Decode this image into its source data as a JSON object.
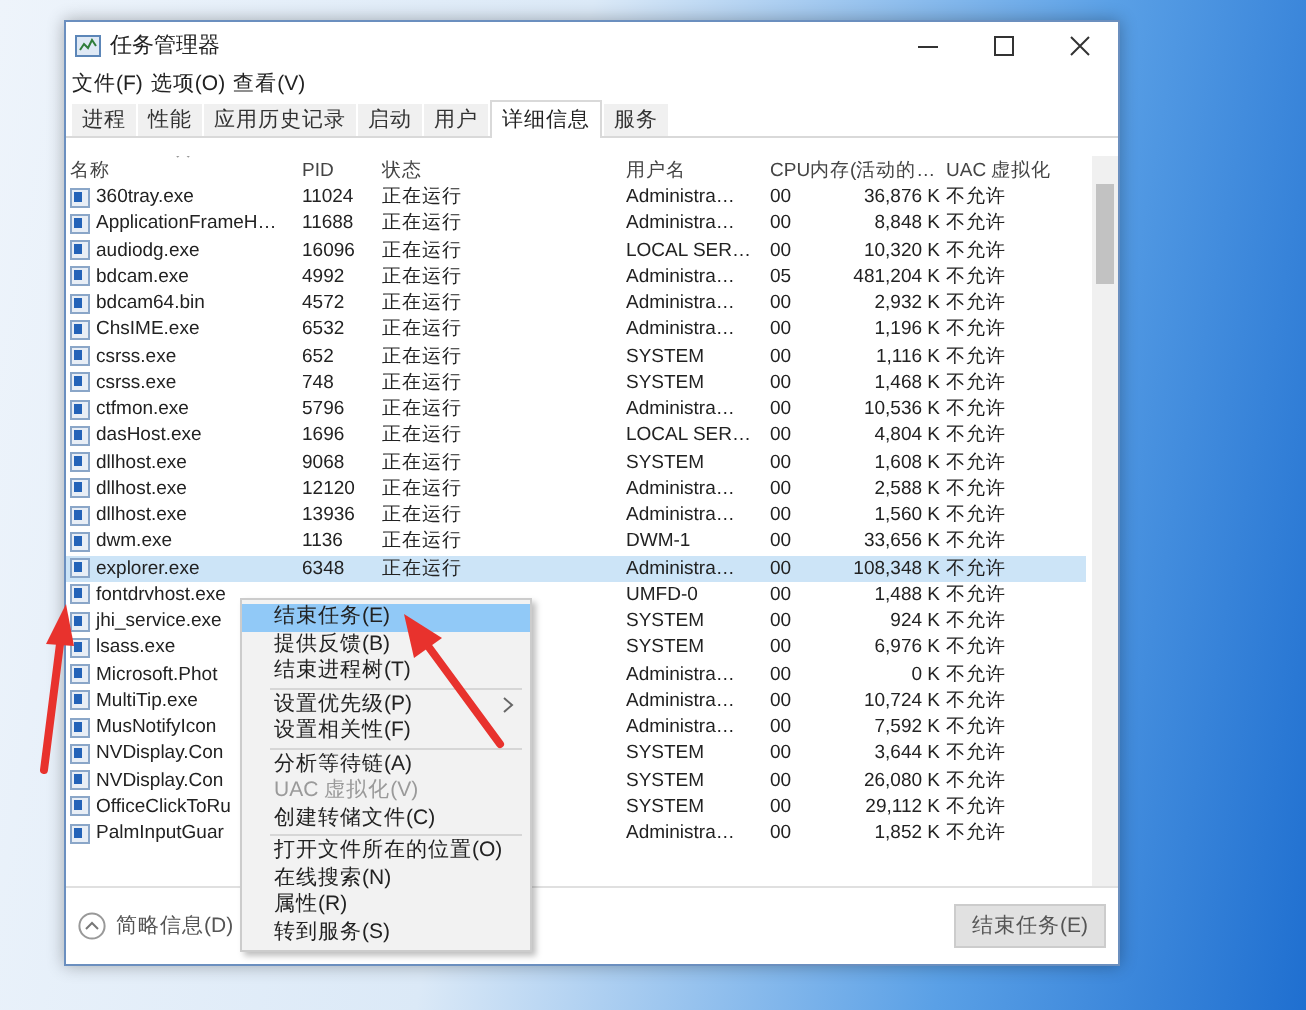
{
  "window": {
    "title": "任务管理器"
  },
  "menu_bar": [
    "文件(F)",
    "选项(O)",
    "查看(V)"
  ],
  "tabs": [
    {
      "label": "进程",
      "selected": false
    },
    {
      "label": "性能",
      "selected": false
    },
    {
      "label": "应用历史记录",
      "selected": false
    },
    {
      "label": "启动",
      "selected": false
    },
    {
      "label": "用户",
      "selected": false
    },
    {
      "label": "详细信息",
      "selected": true
    },
    {
      "label": "服务",
      "selected": false
    }
  ],
  "table": {
    "columns": [
      "名称",
      "PID",
      "状态",
      "用户名",
      "CPU",
      "内存(活动的…",
      "UAC 虚拟化"
    ],
    "rows": [
      {
        "name": "360tray.exe",
        "pid": "11024",
        "status": "正在运行",
        "user": "Administra…",
        "cpu": "00",
        "memory": "36,876 K",
        "uac": "不允许",
        "selected": false
      },
      {
        "name": "ApplicationFrameH…",
        "pid": "11688",
        "status": "正在运行",
        "user": "Administra…",
        "cpu": "00",
        "memory": "8,848 K",
        "uac": "不允许",
        "selected": false
      },
      {
        "name": "audiodg.exe",
        "pid": "16096",
        "status": "正在运行",
        "user": "LOCAL SER…",
        "cpu": "00",
        "memory": "10,320 K",
        "uac": "不允许",
        "selected": false
      },
      {
        "name": "bdcam.exe",
        "pid": "4992",
        "status": "正在运行",
        "user": "Administra…",
        "cpu": "05",
        "memory": "481,204 K",
        "uac": "不允许",
        "selected": false
      },
      {
        "name": "bdcam64.bin",
        "pid": "4572",
        "status": "正在运行",
        "user": "Administra…",
        "cpu": "00",
        "memory": "2,932 K",
        "uac": "不允许",
        "selected": false
      },
      {
        "name": "ChsIME.exe",
        "pid": "6532",
        "status": "正在运行",
        "user": "Administra…",
        "cpu": "00",
        "memory": "1,196 K",
        "uac": "不允许",
        "selected": false
      },
      {
        "name": "csrss.exe",
        "pid": "652",
        "status": "正在运行",
        "user": "SYSTEM",
        "cpu": "00",
        "memory": "1,116 K",
        "uac": "不允许",
        "selected": false
      },
      {
        "name": "csrss.exe",
        "pid": "748",
        "status": "正在运行",
        "user": "SYSTEM",
        "cpu": "00",
        "memory": "1,468 K",
        "uac": "不允许",
        "selected": false
      },
      {
        "name": "ctfmon.exe",
        "pid": "5796",
        "status": "正在运行",
        "user": "Administra…",
        "cpu": "00",
        "memory": "10,536 K",
        "uac": "不允许",
        "selected": false
      },
      {
        "name": "dasHost.exe",
        "pid": "1696",
        "status": "正在运行",
        "user": "LOCAL SER…",
        "cpu": "00",
        "memory": "4,804 K",
        "uac": "不允许",
        "selected": false
      },
      {
        "name": "dllhost.exe",
        "pid": "9068",
        "status": "正在运行",
        "user": "SYSTEM",
        "cpu": "00",
        "memory": "1,608 K",
        "uac": "不允许",
        "selected": false
      },
      {
        "name": "dllhost.exe",
        "pid": "12120",
        "status": "正在运行",
        "user": "Administra…",
        "cpu": "00",
        "memory": "2,588 K",
        "uac": "不允许",
        "selected": false
      },
      {
        "name": "dllhost.exe",
        "pid": "13936",
        "status": "正在运行",
        "user": "Administra…",
        "cpu": "00",
        "memory": "1,560 K",
        "uac": "不允许",
        "selected": false
      },
      {
        "name": "dwm.exe",
        "pid": "1136",
        "status": "正在运行",
        "user": "DWM-1",
        "cpu": "00",
        "memory": "33,656 K",
        "uac": "不允许",
        "selected": false
      },
      {
        "name": "explorer.exe",
        "pid": "6348",
        "status": "正在运行",
        "user": "Administra…",
        "cpu": "00",
        "memory": "108,348 K",
        "uac": "不允许",
        "selected": true
      },
      {
        "name": "fontdrvhost.exe",
        "user": "UMFD-0",
        "cpu": "00",
        "memory": "1,488 K",
        "uac": "不允许",
        "selected": false
      },
      {
        "name": "jhi_service.exe",
        "user": "SYSTEM",
        "cpu": "00",
        "memory": "924 K",
        "uac": "不允许",
        "selected": false
      },
      {
        "name": "lsass.exe",
        "user": "SYSTEM",
        "cpu": "00",
        "memory": "6,976 K",
        "uac": "不允许",
        "selected": false
      },
      {
        "name": "Microsoft.Phot",
        "user": "Administra…",
        "cpu": "00",
        "memory": "0 K",
        "uac": "不允许",
        "selected": false
      },
      {
        "name": "MultiTip.exe",
        "user": "Administra…",
        "cpu": "00",
        "memory": "10,724 K",
        "uac": "不允许",
        "selected": false
      },
      {
        "name": "MusNotifyIcon",
        "user": "Administra…",
        "cpu": "00",
        "memory": "7,592 K",
        "uac": "不允许",
        "selected": false
      },
      {
        "name": "NVDisplay.Con",
        "user": "SYSTEM",
        "cpu": "00",
        "memory": "3,644 K",
        "uac": "不允许",
        "selected": false
      },
      {
        "name": "NVDisplay.Con",
        "user": "SYSTEM",
        "cpu": "00",
        "memory": "26,080 K",
        "uac": "不允许",
        "selected": false
      },
      {
        "name": "OfficeClickToRu",
        "user": "SYSTEM",
        "cpu": "00",
        "memory": "29,112 K",
        "uac": "不允许",
        "selected": false
      },
      {
        "name": "PalmInputGuar",
        "user": "Administra…",
        "cpu": "00",
        "memory": "1,852 K",
        "uac": "不允许",
        "selected": false
      }
    ]
  },
  "context_menu": [
    {
      "kind": "item",
      "label": "结束任务(E)",
      "selected": true,
      "disabled": false
    },
    {
      "kind": "item",
      "label": "提供反馈(B)",
      "selected": false,
      "disabled": false
    },
    {
      "kind": "item",
      "label": "结束进程树(T)",
      "selected": false,
      "disabled": false
    },
    {
      "kind": "separator"
    },
    {
      "kind": "item",
      "label": "设置优先级(P)",
      "selected": false,
      "disabled": false,
      "submenu": true
    },
    {
      "kind": "item",
      "label": "设置相关性(F)",
      "selected": false,
      "disabled": false
    },
    {
      "kind": "separator"
    },
    {
      "kind": "item",
      "label": "分析等待链(A)",
      "selected": false,
      "disabled": false
    },
    {
      "kind": "item",
      "label": "UAC 虚拟化(V)",
      "selected": false,
      "disabled": true
    },
    {
      "kind": "item",
      "label": "创建转储文件(C)",
      "selected": false,
      "disabled": false
    },
    {
      "kind": "separator"
    },
    {
      "kind": "item",
      "label": "打开文件所在的位置(O)",
      "selected": false,
      "disabled": false
    },
    {
      "kind": "item",
      "label": "在线搜索(N)",
      "selected": false,
      "disabled": false
    },
    {
      "kind": "item",
      "label": "属性(R)",
      "selected": false,
      "disabled": false
    },
    {
      "kind": "item",
      "label": "转到服务(S)",
      "selected": false,
      "disabled": false
    }
  ],
  "footer": {
    "details_toggle": "简略信息(D)",
    "end_task_button": "结束任务(E)"
  }
}
